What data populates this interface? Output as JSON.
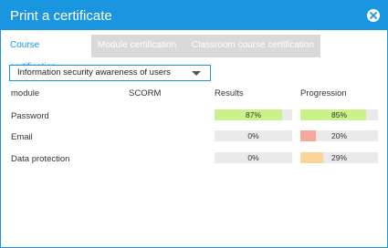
{
  "dialog": {
    "title": "Print a certificate",
    "close_icon": "close-circle-icon",
    "accent": "#1a96e0"
  },
  "tabs": [
    {
      "label": "Course certification",
      "active": true
    },
    {
      "label": "Module certification",
      "active": false
    },
    {
      "label": "Classroom course certification",
      "active": false
    }
  ],
  "course_select": {
    "value": "Information security awareness of users"
  },
  "table": {
    "headers": {
      "module": "module",
      "scorm": "SCORM",
      "results": "Results",
      "progression": "Progression"
    },
    "rows": [
      {
        "module": "Password",
        "scorm": "",
        "results": "87%",
        "results_value": 87,
        "results_color": "#c9f28a",
        "progression": "85%",
        "progression_value": 85,
        "progression_color": "#c9f28a"
      },
      {
        "module": "Email",
        "scorm": "",
        "results": "0%",
        "results_value": 0,
        "results_color": "#c9f28a",
        "progression": "20%",
        "progression_value": 20,
        "progression_color": "#f4a89a"
      },
      {
        "module": "Data protection",
        "scorm": "",
        "results": "0%",
        "results_value": 0,
        "results_color": "#c9f28a",
        "progression": "29%",
        "progression_value": 29,
        "progression_color": "#fbd49a"
      }
    ]
  }
}
